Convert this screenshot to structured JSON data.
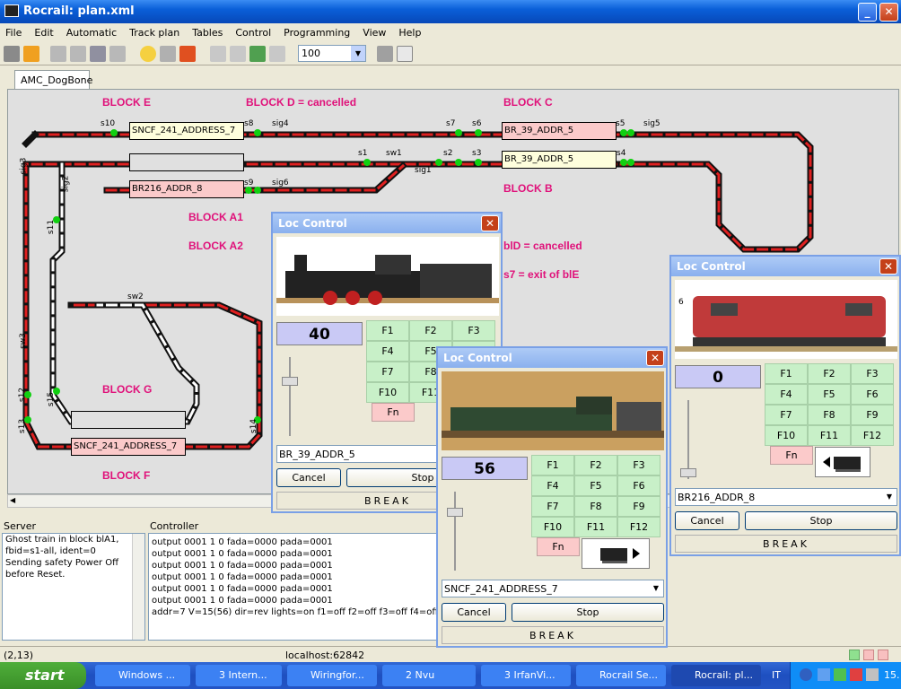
{
  "window": {
    "title": "Rocrail: plan.xml"
  },
  "menu": [
    "File",
    "Edit",
    "Automatic",
    "Track plan",
    "Tables",
    "Control",
    "Programming",
    "View",
    "Help"
  ],
  "toolbar": {
    "zoom": "100"
  },
  "tabs": {
    "plan": "AMC_DogBone"
  },
  "plan": {
    "labels": {
      "blockE": "BLOCK E",
      "blockD": "BLOCK D = cancelled",
      "blockC": "BLOCK C",
      "blockB": "BLOCK B",
      "blockA1": "BLOCK A1",
      "blockA2": "BLOCK A2",
      "bld": "blD = cancelled",
      "s7note": "s7 = exit of blE",
      "blockG": "BLOCK G",
      "blockF": "BLOCK F"
    },
    "blocks": {
      "e": "SNCF_241_ADDRESS_7",
      "c": "BR_39_ADDR_5",
      "b": "BR_39_ADDR_5",
      "a1": "BR216_ADDR_8",
      "f": "SNCF_241_ADDRESS_7",
      "middle": "",
      "g": ""
    },
    "sensors": {
      "s10": "s10",
      "s8": "s8",
      "sig4": "sig4",
      "s7": "s7",
      "s6": "s6",
      "s5": "s5",
      "sig5": "sig5",
      "s1": "s1",
      "sw1": "sw1",
      "s2": "s2",
      "s3": "s3",
      "s4": "s4",
      "sig1": "sig1",
      "sig3": "sig3",
      "sig2": "sig2",
      "s9": "s9",
      "sig6": "sig6",
      "s11": "s11",
      "sw2": "sw2",
      "sw3": "sw3",
      "s12": "s12",
      "s15": "s15",
      "s13": "s13",
      "s14": "s14"
    }
  },
  "server": {
    "title": "Server",
    "lines": [
      "Ghost train in block blA1,",
      "fbid=s1-all, ident=0",
      "Sending safety Power Off",
      "before Reset."
    ]
  },
  "controller": {
    "title": "Controller",
    "lines": [
      "output 0001 1 0 fada=0000 pada=0001",
      "output 0001 1 0 fada=0000 pada=0001",
      "output 0001 1 0 fada=0000 pada=0001",
      "output 0001 1 0 fada=0000 pada=0001",
      "output 0001 1 0 fada=0000 pada=0001",
      "output 0001 1 0 fada=0000 pada=0001",
      "addr=7 V=15(56) dir=rev lights=on f1=off f2=off f3=off f4=off"
    ]
  },
  "status": {
    "coords": "(2,13)",
    "host": "localhost:62842"
  },
  "loc1": {
    "title": "Loc Control",
    "speed": "40",
    "f": [
      "F1",
      "F2",
      "F3",
      "F4",
      "F5",
      "",
      "F7",
      "F8",
      "",
      "F10",
      "F11",
      ""
    ],
    "fn": "Fn",
    "loco": "BR_39_ADDR_5",
    "cancel": "Cancel",
    "stop": "Stop",
    "break": "BREAK"
  },
  "loc2": {
    "title": "Loc Control",
    "speed": "56",
    "f": [
      "F1",
      "F2",
      "F3",
      "F4",
      "F5",
      "F6",
      "F7",
      "F8",
      "F9",
      "F10",
      "F11",
      "F12"
    ],
    "fn": "Fn",
    "loco": "SNCF_241_ADDRESS_7",
    "cancel": "Cancel",
    "stop": "Stop",
    "break": "BREAK"
  },
  "loc3": {
    "title": "Loc Control",
    "speed": "0",
    "f": [
      "F1",
      "F2",
      "F3",
      "F4",
      "F5",
      "F6",
      "F7",
      "F8",
      "F9",
      "F10",
      "F11",
      "F12"
    ],
    "fn": "Fn",
    "loco": "BR216_ADDR_8",
    "cancel": "Cancel",
    "stop": "Stop",
    "break": "BREAK",
    "photo_number": "6"
  },
  "taskbar": {
    "start": "start",
    "tasks": [
      "Windows ...",
      "3 Intern...",
      "Wiringfor...",
      "2 Nvu",
      "3 IrfanVi...",
      "Rocrail Se...",
      "Rocrail: pl..."
    ],
    "lang": "IT",
    "clock": "15."
  }
}
